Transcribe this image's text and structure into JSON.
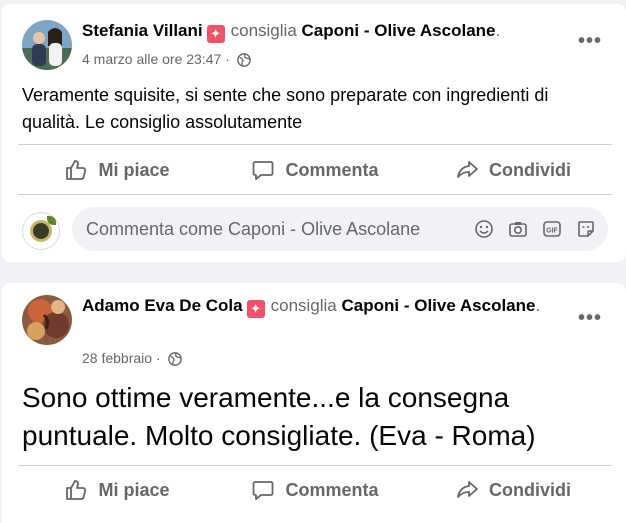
{
  "posts": [
    {
      "author": "Stefania Villani",
      "verb": "consiglia",
      "page": "Caponi - Olive Ascolane",
      "page_suffix": ".",
      "timestamp": "4 marzo alle ore 23:47 ·",
      "text": "Veramente squisite, si sente che sono preparate con ingredienti di qualità. Le consiglio assolutamente"
    },
    {
      "author": "Adamo Eva De Cola",
      "verb": "consiglia",
      "page": "Caponi - Olive Ascolane",
      "page_suffix": ".",
      "timestamp": "28 febbraio ·",
      "text": "Sono ottime veramente...e la consegna puntuale. Molto consigliate. (Eva - Roma)"
    }
  ],
  "actions": {
    "like": "Mi piace",
    "comment": "Commenta",
    "share": "Condividi"
  },
  "comment_box": {
    "placeholder": "Commenta come Caponi - Olive Ascolane",
    "icons": [
      "smile-icon",
      "camera-icon",
      "gif-icon",
      "sticker-icon"
    ]
  },
  "icons": {
    "more": "more-options-icon",
    "audience": "globe-icon",
    "like": "thumbs-up-icon",
    "comment": "comment-bubble-icon",
    "share": "share-arrow-icon"
  },
  "colors": {
    "background": "#f0f2f5",
    "card": "#ffffff",
    "secondary_text": "#65676b",
    "recommend_badge": "#f25268"
  }
}
